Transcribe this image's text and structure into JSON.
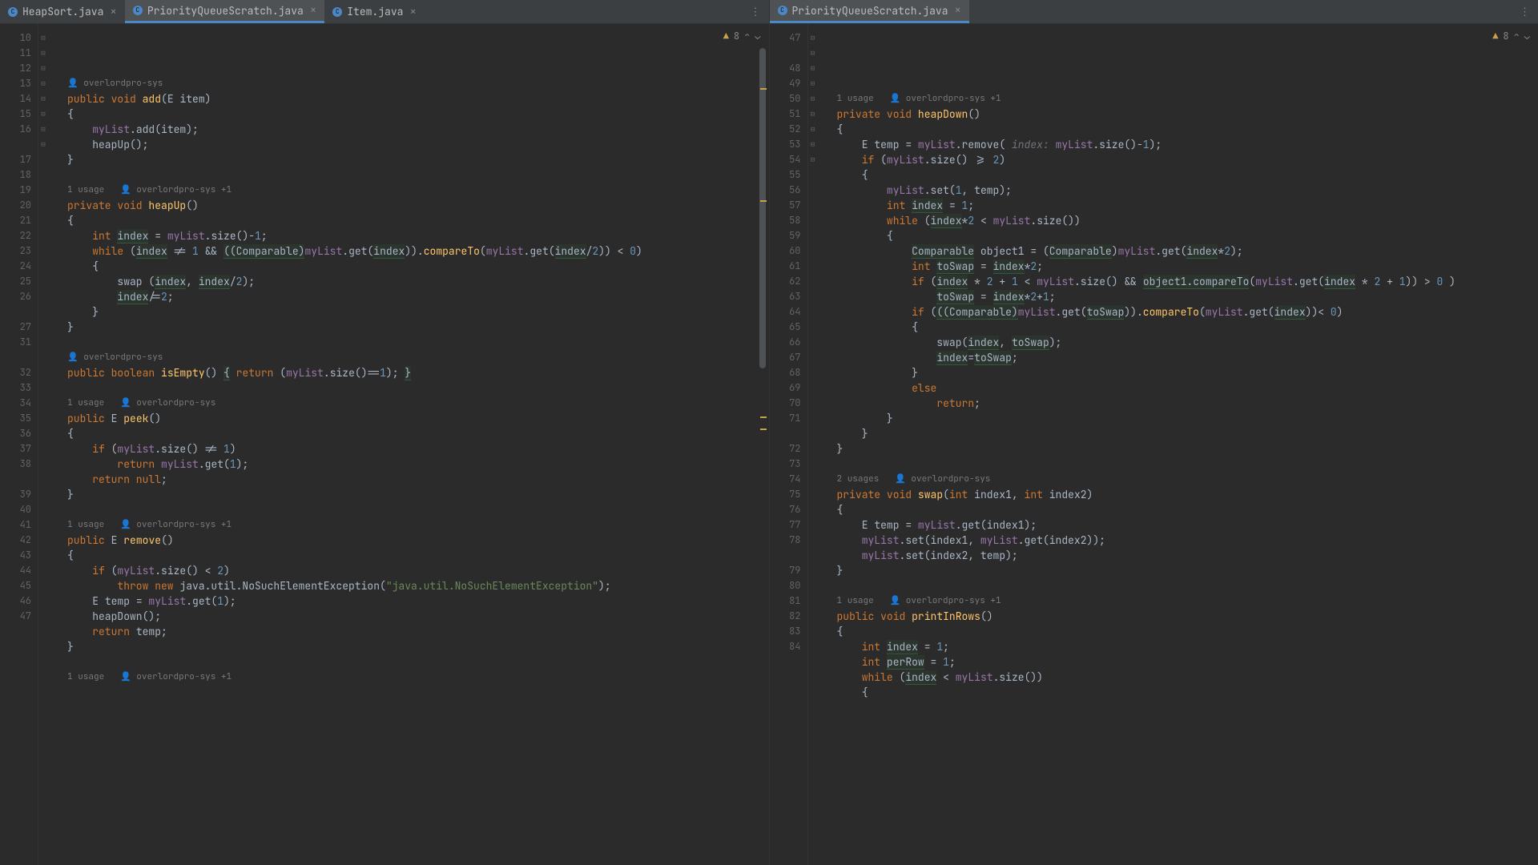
{
  "tabs_left": [
    {
      "name": "HeapSort.java",
      "active": false
    },
    {
      "name": "PriorityQueueScratch.java",
      "active": true
    },
    {
      "name": "Item.java",
      "active": false
    }
  ],
  "tabs_right": [
    {
      "name": "PriorityQueueScratch.java",
      "active": true
    }
  ],
  "warning_count": "8",
  "hints": {
    "u1": "1 usage",
    "u2": "2 usages",
    "a1": "overlordpro-sys",
    "a2": "overlordpro-sys +1"
  },
  "left_lines": [
    "10",
    "11",
    "12",
    "13",
    "14",
    "15",
    "16",
    "",
    "17",
    "18",
    "19",
    "20",
    "21",
    "22",
    "23",
    "24",
    "25",
    "26",
    "",
    "27",
    "31",
    "",
    "32",
    "33",
    "34",
    "35",
    "36",
    "37",
    "38",
    "",
    "39",
    "40",
    "41",
    "42",
    "43",
    "44",
    "45",
    "46",
    "47",
    ""
  ],
  "right_lines": [
    "47",
    "",
    "48",
    "49",
    "50",
    "51",
    "52",
    "53",
    "54",
    "55",
    "56",
    "57",
    "58",
    "59",
    "60",
    "61",
    "62",
    "63",
    "64",
    "65",
    "66",
    "67",
    "68",
    "69",
    "70",
    "71",
    "",
    "72",
    "73",
    "74",
    "75",
    "76",
    "77",
    "78",
    "",
    "79",
    "80",
    "81",
    "82",
    "83",
    "84",
    ""
  ],
  "code_left": [
    {
      "ann": true,
      "usages": "",
      "author": "overlordpro-sys"
    },
    {
      "html": "<span class='kw'>public void</span> <span class='mth'>add</span>(<span class='ty'>E</span> item)"
    },
    {
      "html": "{"
    },
    {
      "html": "    <span class='fld'>myList</span>.add(item);"
    },
    {
      "html": "    heapUp();"
    },
    {
      "html": "}"
    },
    {
      "html": ""
    },
    {
      "ann": true,
      "usages": "1 usage",
      "author": "overlordpro-sys +1"
    },
    {
      "html": "<span class='kw'>private void</span> <span class='mth'>heapUp</span>()"
    },
    {
      "html": "{"
    },
    {
      "html": "    <span class='kw'>int</span> <span class='hl'>index</span> = <span class='fld'>myList</span>.size()-<span class='num'>1</span>;"
    },
    {
      "html": "    <span class='kw'>while</span> (<span class='hl'>index</span> != <span class='num'>1</span> && <span class='hl'>((Comparable)</span><span class='fld'>myList</span>.get(<span class='hl'>index</span>)).<span class='mth'>compareTo</span>(<span class='fld'>myList</span>.get(<span class='hl'>index</span>/<span class='num'>2</span>)) &lt; <span class='num'>0</span>)"
    },
    {
      "html": "    {"
    },
    {
      "html": "        swap (<span class='hl'>index</span>, <span class='hl'>index</span>/<span class='num'>2</span>);"
    },
    {
      "html": "        <span class='hl'>index</span>/=<span class='num'>2</span>;"
    },
    {
      "html": "    }"
    },
    {
      "html": "}"
    },
    {
      "html": ""
    },
    {
      "ann": true,
      "usages": "",
      "author": "overlordpro-sys"
    },
    {
      "html": "<span class='kw'>public boolean</span> <span class='mth'>isEmpty</span>() <span class='hl'>{</span> <span class='kw'>return</span> (<span class='fld'>myList</span>.size()==<span class='num'>1</span>); <span class='hl'>}</span>"
    },
    {
      "html": ""
    },
    {
      "ann": true,
      "usages": "1 usage",
      "author": "overlordpro-sys"
    },
    {
      "html": "<span class='kw'>public</span> <span class='ty'>E</span> <span class='mth'>peek</span>()"
    },
    {
      "html": "{"
    },
    {
      "html": "    <span class='kw'>if</span> (<span class='fld'>myList</span>.size() != <span class='num'>1</span>)"
    },
    {
      "html": "        <span class='kw'>return</span> <span class='fld'>myList</span>.get(<span class='num'>1</span>);"
    },
    {
      "html": "    <span class='kw'>return null</span>;"
    },
    {
      "html": "}"
    },
    {
      "html": ""
    },
    {
      "ann": true,
      "usages": "1 usage",
      "author": "overlordpro-sys +1"
    },
    {
      "html": "<span class='kw'>public</span> <span class='ty'>E</span> <span class='mth'>remove</span>()"
    },
    {
      "html": "{"
    },
    {
      "html": "    <span class='kw'>if</span> (<span class='fld'>myList</span>.size() &lt; <span class='num'>2</span>)"
    },
    {
      "html": "        <span class='kw'>throw new</span> java.util.NoSuchElementException(<span class='str'>\"java.util.NoSuchElementException\"</span>);"
    },
    {
      "html": "    <span class='ty'>E</span> temp = <span class='fld'>myList</span>.get(<span class='num'>1</span>);"
    },
    {
      "html": "    heapDown();"
    },
    {
      "html": "    <span class='kw'>return</span> temp;"
    },
    {
      "html": "}"
    },
    {
      "html": ""
    },
    {
      "ann": true,
      "usages": "1 usage",
      "author": "overlordpro-sys +1"
    }
  ],
  "code_right": [
    {
      "html": ""
    },
    {
      "ann": true,
      "usages": "1 usage",
      "author": "overlordpro-sys +1"
    },
    {
      "html": "<span class='kw'>private void</span> <span class='mth'>heapDown</span>()"
    },
    {
      "html": "{"
    },
    {
      "html": "    <span class='ty'>E</span> temp = <span class='fld'>myList</span>.remove( <span class='parm'>index:</span> <span class='fld'>myList</span>.size()-<span class='num'>1</span>);"
    },
    {
      "html": "    <span class='kw'>if</span> (<span class='fld'>myList</span>.size() &gt;= <span class='num'>2</span>)"
    },
    {
      "html": "    {"
    },
    {
      "html": "        <span class='fld'>myList</span>.set(<span class='num'>1</span>, temp);"
    },
    {
      "html": "        <span class='kw'>int</span> <span class='hl'>index</span> = <span class='num'>1</span>;"
    },
    {
      "html": "        <span class='kw'>while</span> (<span class='hl'>index</span>*<span class='num'>2</span> &lt; <span class='fld'>myList</span>.size())"
    },
    {
      "html": "        {"
    },
    {
      "html": "            <span class='hl'>Comparable</span> object1 = (<span class='hl'>Comparable</span>)<span class='fld'>myList</span>.get(<span class='hl'>index</span>*<span class='num'>2</span>);"
    },
    {
      "html": "            <span class='kw'>int</span> <span class='hl'>toSwap</span> = <span class='hl'>index</span>*<span class='num'>2</span>;"
    },
    {
      "html": "            <span class='kw'>if</span> (<span class='hl'>index</span> * <span class='num'>2</span> + <span class='num'>1</span> &lt; <span class='fld'>myList</span>.size() && <span class='hl'>object1.compareTo</span>(<span class='fld'>myList</span>.get(<span class='hl'>index</span> * <span class='num'>2</span> + <span class='num'>1</span>)) &gt; <span class='num'>0</span> )"
    },
    {
      "html": "                <span class='hl'>toSwap</span> = <span class='hl'>index</span>*<span class='num'>2</span>+<span class='num'>1</span>;"
    },
    {
      "html": "            <span class='kw'>if</span> (<span class='hl'>((Comparable)</span><span class='fld'>myList</span>.get(<span class='hl'>toSwap</span>)).<span class='mth'>compareTo</span>(<span class='fld'>myList</span>.get(<span class='hl'>index</span>))&lt; <span class='num'>0</span>)"
    },
    {
      "html": "            {"
    },
    {
      "html": "                swap(<span class='hl'>index</span>, <span class='hl'>toSwap</span>);"
    },
    {
      "html": "                <span class='hl'>index</span>=<span class='hl'>toSwap</span>;"
    },
    {
      "html": "            }"
    },
    {
      "html": "            <span class='kw'>else</span>"
    },
    {
      "html": "                <span class='kw'>return</span>;"
    },
    {
      "html": "        }"
    },
    {
      "html": "    }"
    },
    {
      "html": "}"
    },
    {
      "html": ""
    },
    {
      "ann": true,
      "usages": "2 usages",
      "author": "overlordpro-sys"
    },
    {
      "html": "<span class='kw'>private void</span> <span class='mth'>swap</span>(<span class='kw'>int</span> index1, <span class='kw'>int</span> index2)"
    },
    {
      "html": "{"
    },
    {
      "html": "    <span class='ty'>E</span> temp = <span class='fld'>myList</span>.get(index1);"
    },
    {
      "html": "    <span class='fld'>myList</span>.set(index1, <span class='fld'>myList</span>.get(index2));"
    },
    {
      "html": "    <span class='fld'>myList</span>.set(index2, temp);"
    },
    {
      "html": "}"
    },
    {
      "html": ""
    },
    {
      "ann": true,
      "usages": "1 usage",
      "author": "overlordpro-sys +1"
    },
    {
      "html": "<span class='kw'>public void</span> <span class='mth'>printInRows</span>()"
    },
    {
      "html": "{"
    },
    {
      "html": "    <span class='kw'>int</span> <span class='hl'>index</span> = <span class='num'>1</span>;"
    },
    {
      "html": "    <span class='kw'>int</span> <span class='hl'>perRow</span> = <span class='num'>1</span>;"
    },
    {
      "html": "    <span class='kw'>while</span> (<span class='hl'>index</span> &lt; <span class='fld'>myList</span>.size())"
    },
    {
      "html": "    {"
    }
  ]
}
